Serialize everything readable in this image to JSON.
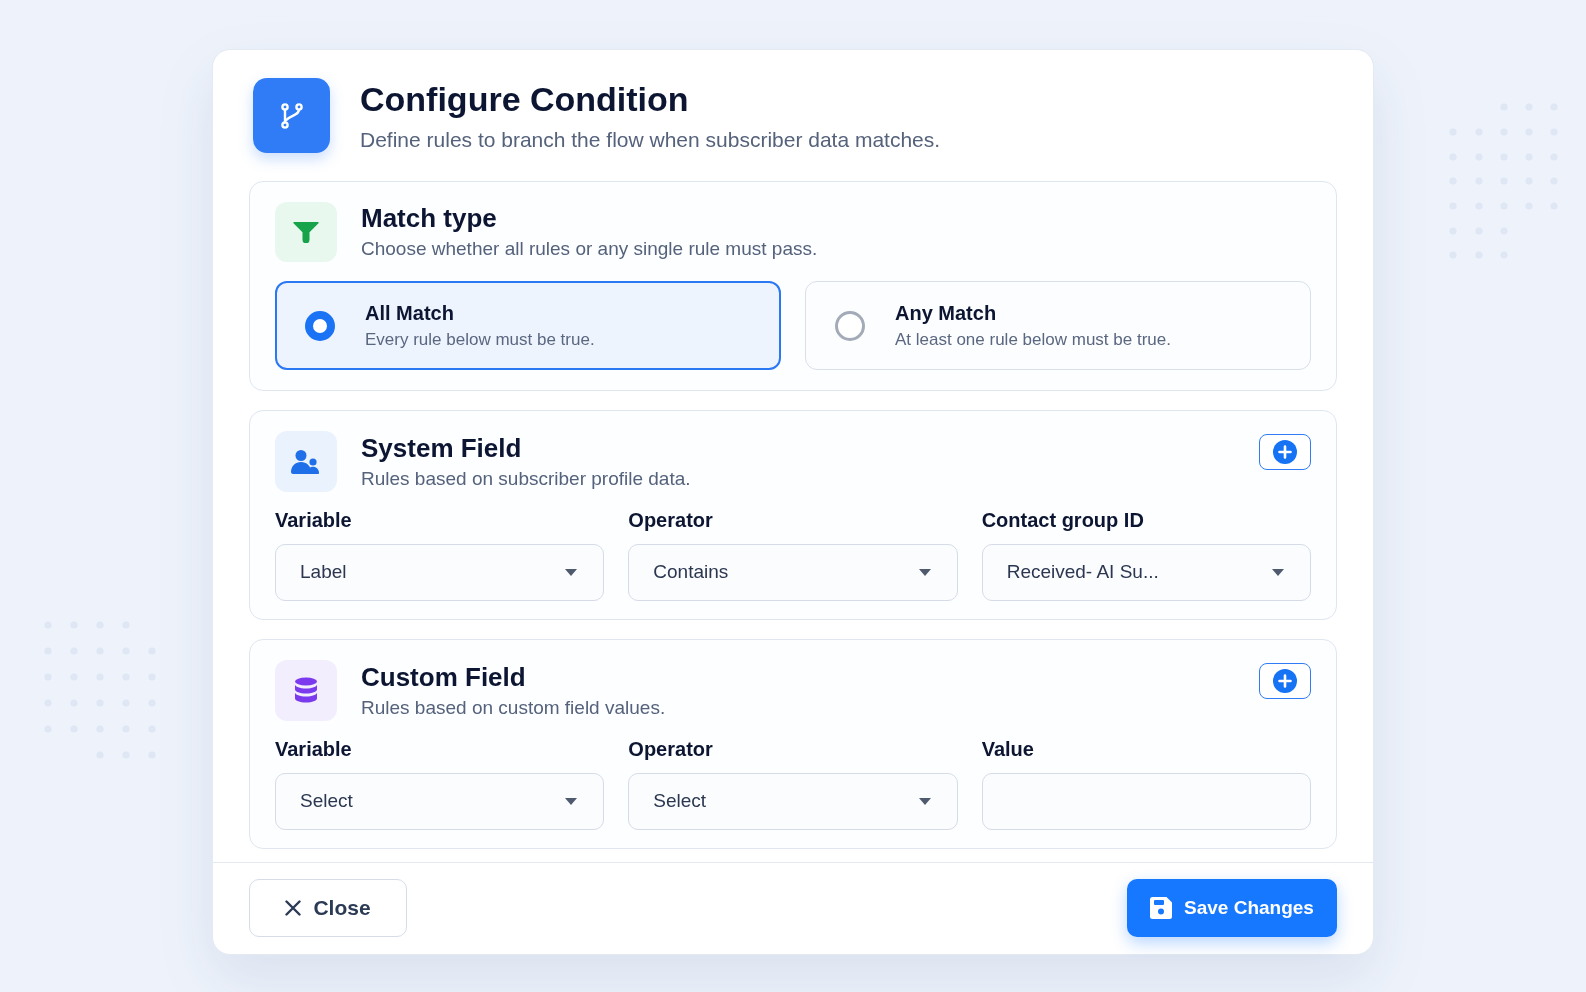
{
  "dialog": {
    "title": "Configure Condition",
    "subtitle": "Define rules to branch the flow when subscriber data matches."
  },
  "match_type": {
    "title": "Match type",
    "description": "Choose whether all rules or any single rule must pass.",
    "options": [
      {
        "label": "All Match",
        "description": "Every rule below must be true.",
        "selected": true
      },
      {
        "label": "Any Match",
        "description": "At least one rule below must be true.",
        "selected": false
      }
    ]
  },
  "sections": [
    {
      "kind": "system",
      "title": "System Field",
      "description": "Rules based on subscriber profile data.",
      "fields": [
        {
          "kind": "select",
          "label": "Variable",
          "value": "Label"
        },
        {
          "kind": "select",
          "label": "Operator",
          "value": "Contains"
        },
        {
          "kind": "select",
          "label": "Contact group ID",
          "value": "Received- AI Su..."
        }
      ]
    },
    {
      "kind": "custom",
      "title": "Custom Field",
      "description": "Rules based on custom field values.",
      "fields": [
        {
          "kind": "select",
          "label": "Variable",
          "value": "Select"
        },
        {
          "kind": "select",
          "label": "Operator",
          "value": "Select"
        },
        {
          "kind": "text",
          "label": "Value"
        }
      ]
    }
  ],
  "footer": {
    "buttons": [
      {
        "kind": "close",
        "label": "Close"
      },
      {
        "kind": "save",
        "label": "Save Changes"
      }
    ]
  }
}
